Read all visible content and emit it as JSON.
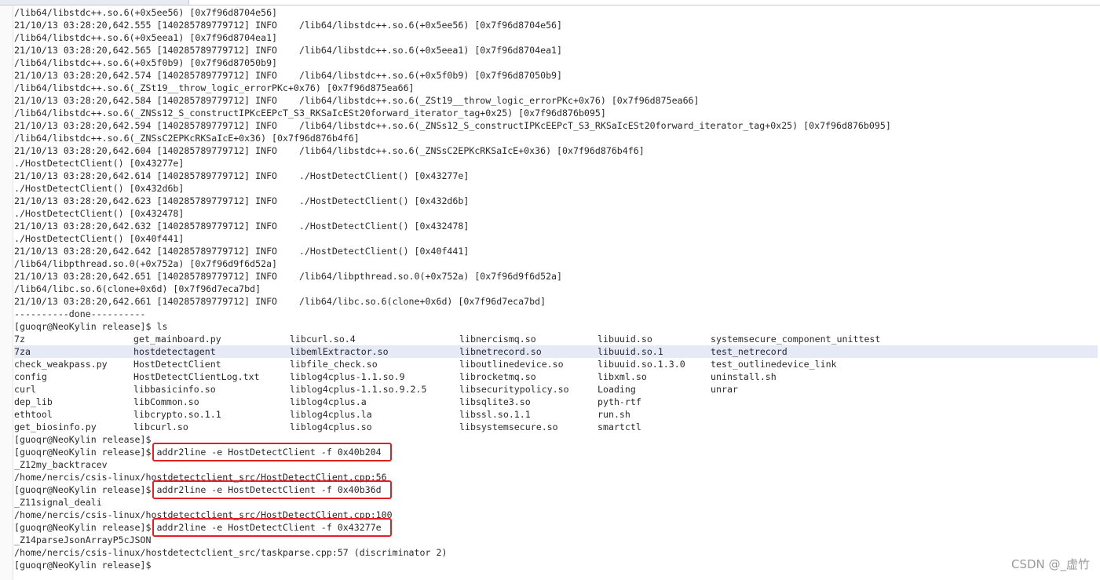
{
  "terminal": {
    "log_lines": [
      "/lib64/libstdc++.so.6(+0x5ee56) [0x7f96d8704e56]",
      "21/10/13 03:28:20,642.555 [140285789779712] INFO    /lib64/libstdc++.so.6(+0x5ee56) [0x7f96d8704e56]",
      "/lib64/libstdc++.so.6(+0x5eea1) [0x7f96d8704ea1]",
      "21/10/13 03:28:20,642.565 [140285789779712] INFO    /lib64/libstdc++.so.6(+0x5eea1) [0x7f96d8704ea1]",
      "/lib64/libstdc++.so.6(+0x5f0b9) [0x7f96d87050b9]",
      "21/10/13 03:28:20,642.574 [140285789779712] INFO    /lib64/libstdc++.so.6(+0x5f0b9) [0x7f96d87050b9]",
      "/lib64/libstdc++.so.6(_ZSt19__throw_logic_errorPKc+0x76) [0x7f96d875ea66]",
      "21/10/13 03:28:20,642.584 [140285789779712] INFO    /lib64/libstdc++.so.6(_ZSt19__throw_logic_errorPKc+0x76) [0x7f96d875ea66]",
      "/lib64/libstdc++.so.6(_ZNSs12_S_constructIPKcEEPcT_S3_RKSaIcESt20forward_iterator_tag+0x25) [0x7f96d876b095]",
      "21/10/13 03:28:20,642.594 [140285789779712] INFO    /lib64/libstdc++.so.6(_ZNSs12_S_constructIPKcEEPcT_S3_RKSaIcESt20forward_iterator_tag+0x25) [0x7f96d876b095]",
      "/lib64/libstdc++.so.6(_ZNSsC2EPKcRKSaIcE+0x36) [0x7f96d876b4f6]",
      "21/10/13 03:28:20,642.604 [140285789779712] INFO    /lib64/libstdc++.so.6(_ZNSsC2EPKcRKSaIcE+0x36) [0x7f96d876b4f6]",
      "./HostDetectClient() [0x43277e]",
      "21/10/13 03:28:20,642.614 [140285789779712] INFO    ./HostDetectClient() [0x43277e]",
      "./HostDetectClient() [0x432d6b]",
      "21/10/13 03:28:20,642.623 [140285789779712] INFO    ./HostDetectClient() [0x432d6b]",
      "./HostDetectClient() [0x432478]",
      "21/10/13 03:28:20,642.632 [140285789779712] INFO    ./HostDetectClient() [0x432478]",
      "./HostDetectClient() [0x40f441]",
      "21/10/13 03:28:20,642.642 [140285789779712] INFO    ./HostDetectClient() [0x40f441]",
      "/lib64/libpthread.so.0(+0x752a) [0x7f96d9f6d52a]",
      "21/10/13 03:28:20,642.651 [140285789779712] INFO    /lib64/libpthread.so.0(+0x752a) [0x7f96d9f6d52a]",
      "/lib64/libc.so.6(clone+0x6d) [0x7f96d7eca7bd]",
      "21/10/13 03:28:20,642.661 [140285789779712] INFO    /lib64/libc.so.6(clone+0x6d) [0x7f96d7eca7bd]",
      "----------done----------"
    ],
    "ls_prompt": "[guoqr@NeoKylin release]$ ls",
    "ls_rows": [
      [
        "7z",
        "get_mainboard.py",
        "libcurl.so.4",
        "libnercismq.so",
        "libuuid.so",
        "systemsecure_component_unittest"
      ],
      [
        "7za",
        "hostdetectagent",
        "libemlExtractor.so",
        "libnetrecord.so",
        "libuuid.so.1",
        "test_netrecord"
      ],
      [
        "check_weakpass.py",
        "HostDetectClient",
        "libfile_check.so",
        "liboutlinedevice.so",
        "libuuid.so.1.3.0",
        "test_outlinedevice_link"
      ],
      [
        "config",
        "HostDetectClientLog.txt",
        "liblog4cplus-1.1.so.9",
        "librocketmq.so",
        "libxml.so",
        "uninstall.sh"
      ],
      [
        "curl",
        "libbasicinfo.so",
        "liblog4cplus-1.1.so.9.2.5",
        "libsecuritypolicy.so",
        "Loading",
        "unrar"
      ],
      [
        "dep_lib",
        "libCommon.so",
        "liblog4cplus.a",
        "libsqlite3.so",
        "pyth-rtf",
        ""
      ],
      [
        "ethtool",
        "libcrypto.so.1.1",
        "liblog4cplus.la",
        "libssl.so.1.1",
        "run.sh",
        ""
      ],
      [
        "get_biosinfo.py",
        "libcurl.so",
        "liblog4cplus.so",
        "libsystemsecure.so",
        "smartctl",
        ""
      ]
    ],
    "empty_prompt": "[guoqr@NeoKylin release]$",
    "prompt": "[guoqr@NeoKylin release]$ ",
    "cmd1": "addr2line -e HostDetectClient -f 0x40b204",
    "out1_func": "_Z12my_backtracev",
    "out1_file": "/home/nercis/csis-linux/hostdetectclient_src/HostDetectClient.cpp:56",
    "cmd2": "addr2line -e HostDetectClient -f 0x40b36d",
    "out2_func": "_Z11signal_deali",
    "out2_file": "/home/nercis/csis-linux/hostdetectclient_src/HostDetectClient.cpp:100",
    "cmd3": "addr2line -e HostDetectClient -f 0x43277e",
    "out3_func": "_Z14parseJsonArrayP5cJSON",
    "out3_file": "/home/nercis/csis-linux/hostdetectclient_src/taskparse.cpp:57 (discriminator 2)",
    "final_prompt": "[guoqr@NeoKylin release]$"
  },
  "highlight_color": "#e32020",
  "watermark": "CSDN @_虚竹"
}
